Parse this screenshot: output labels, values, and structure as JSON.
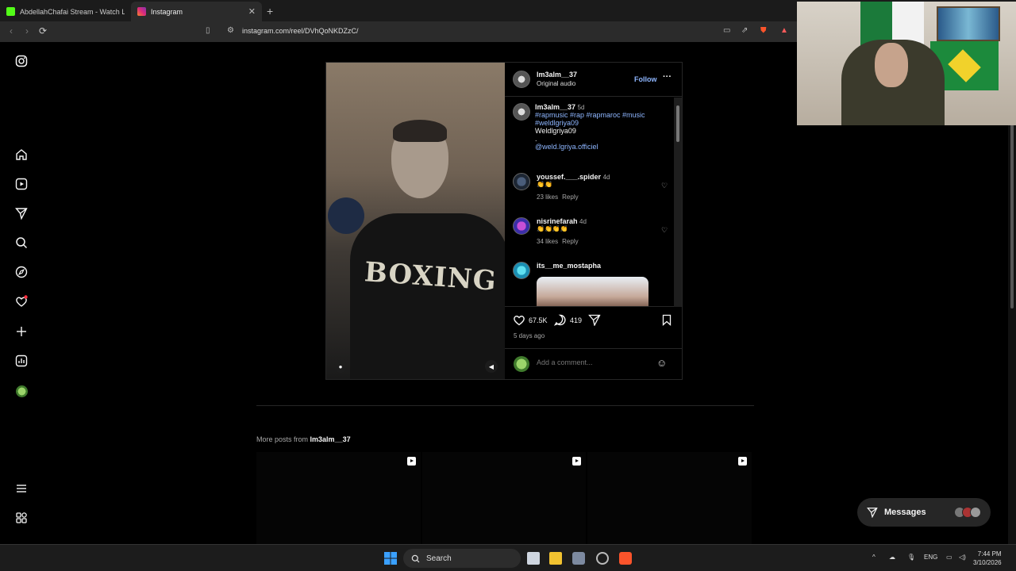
{
  "browser": {
    "tabs": [
      {
        "title": "AbdellahChafai Stream - Watch Live",
        "favicon": "kick-icon",
        "color": "#53fc18"
      },
      {
        "title": "Instagram",
        "favicon": "instagram-icon",
        "color": "#e1306c"
      }
    ],
    "url": "instagram.com/reel/DVhQoNKDZzC/"
  },
  "sidebar": {
    "items": [
      "instagram-logo",
      "home",
      "reels",
      "messages",
      "search",
      "explore",
      "notifications",
      "create",
      "dashboard",
      "profile",
      "more",
      "also-from-meta"
    ]
  },
  "post": {
    "username": "lm3alm__37",
    "audio": "Original audio",
    "follow_label": "Follow",
    "caption": {
      "username": "lm3alm__37",
      "age": "5d",
      "hashtags_line1": "#rapmusic #rap #rapmaroc #music",
      "hashtags_line2": "#weldlgriya09",
      "text": "Weldlgriya09",
      "dot": ".",
      "mention": "@weld.lgriya.officiel"
    },
    "comments": [
      {
        "username": "youssef.___.spider",
        "age": "4d",
        "text": "👏👏",
        "likes": "23 likes",
        "reply": "Reply"
      },
      {
        "username": "nisrinefarah",
        "age": "4d",
        "text": "👏👏👏👏",
        "likes": "34 likes",
        "reply": "Reply"
      },
      {
        "username": "its__me_mostapha",
        "age": "",
        "text": "",
        "likes": "",
        "reply": ""
      }
    ],
    "likes": "67.5K",
    "comments_count": "419",
    "posted": "5 days ago",
    "add_comment_placeholder": "Add a comment..."
  },
  "video": {
    "shirt_text": "BOXING"
  },
  "more_posts": {
    "prefix": "More posts from",
    "username": "lm3alm__37"
  },
  "messages": {
    "label": "Messages"
  },
  "taskbar": {
    "search_label": "Search",
    "lang": "ENG",
    "time": "7:44 PM",
    "date": "3/10/2026"
  }
}
